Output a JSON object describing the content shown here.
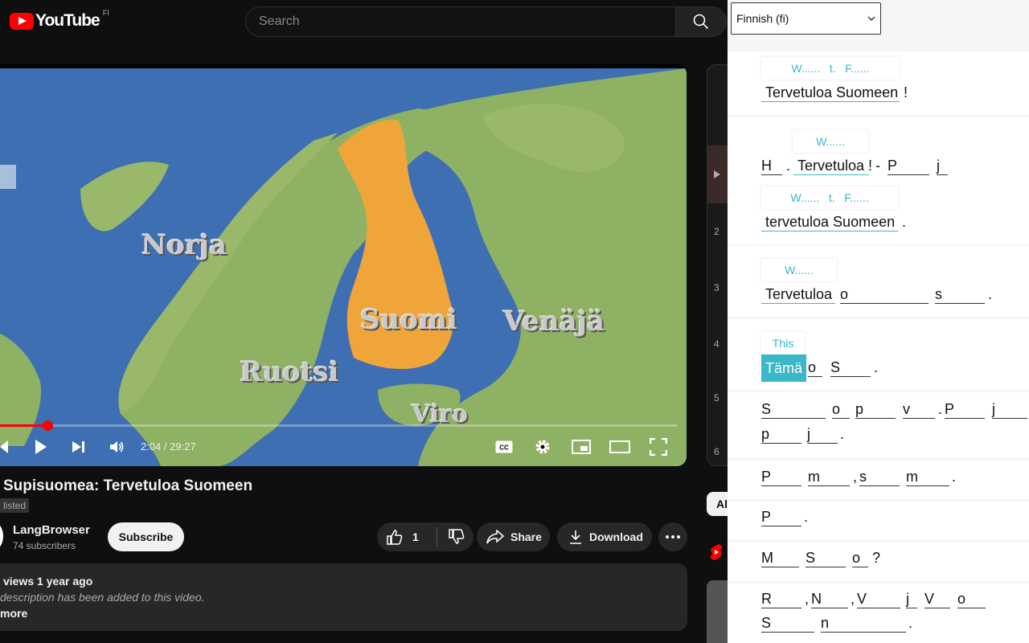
{
  "header": {
    "logo_text": "YouTube",
    "country_code": "FI",
    "search_placeholder": "Search"
  },
  "video": {
    "map_labels": {
      "norja": "Norja",
      "suomi": "Suomi",
      "venaja": "Venäjä",
      "ruotsi": "Ruotsi",
      "viro": "Viro"
    },
    "time": "2:04 / 29:27",
    "progress": 0.07,
    "colors": {
      "sea": "#3f6fb3",
      "land": "#8fb163",
      "finland": "#f0a53a",
      "progress": "#ff0000"
    }
  },
  "meta": {
    "title": "Supisuomea: Tervetuloa Suomeen",
    "visibility": "listed",
    "channel": "LangBrowser",
    "subscribers": "74 subscribers",
    "subscribe_label": "Subscribe",
    "likes": "1",
    "share_label": "Share",
    "download_label": "Download"
  },
  "description": {
    "stats": "views  1 year ago",
    "text": "description has been added to this video.",
    "more": "more"
  },
  "playlist": {
    "numbers": [
      "2",
      "3",
      "4",
      "5",
      "6"
    ],
    "all_label": "Al"
  },
  "panel": {
    "language": "Finnish (fi)",
    "accent": "#3ab7c9",
    "lines": {
      "l1": {
        "gloss": [
          "W......",
          "t.",
          "F......"
        ],
        "tokens": [
          "Tervetuloa Suomeen",
          "!"
        ]
      },
      "l2": {
        "gloss1": [
          "W......"
        ],
        "tokens1": [
          "H",
          ".",
          "Tervetuloa",
          "!",
          "-",
          "P",
          "j"
        ],
        "gloss2": [
          "W......",
          "t.",
          "F......"
        ],
        "tokens2": [
          "tervetuloa Suomeen",
          "."
        ]
      },
      "l3": {
        "gloss": [
          "W......"
        ],
        "tokens": [
          "Tervetuloa",
          "o",
          "s",
          "."
        ]
      },
      "l4": {
        "gloss": [
          "This"
        ],
        "tokens": [
          "Tämä",
          "o",
          "S",
          "."
        ]
      },
      "l5": {
        "tokens1": [
          "S",
          "o",
          "p",
          "v",
          ".",
          "P",
          "j"
        ],
        "tokens2": [
          "p",
          "j",
          "."
        ]
      },
      "l6": {
        "tokens": [
          "P",
          "m",
          ",",
          "s",
          "m",
          "."
        ]
      },
      "l7": {
        "tokens": [
          "P",
          "."
        ]
      },
      "l8": {
        "tokens": [
          "M",
          "S",
          "o",
          "?"
        ]
      },
      "l9": {
        "tokens1": [
          "R",
          ",",
          "N",
          ",",
          "V",
          "j",
          "V",
          "o"
        ],
        "tokens2": [
          "S",
          "n",
          "."
        ]
      }
    }
  }
}
